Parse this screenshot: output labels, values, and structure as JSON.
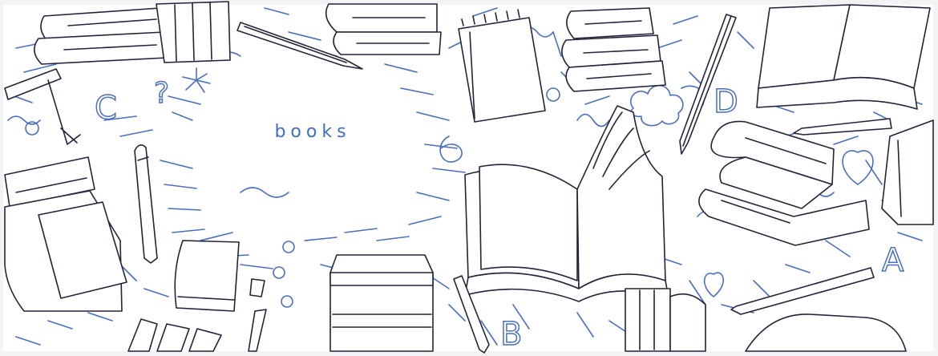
{
  "banner": {
    "title": "books",
    "colors": {
      "accent": "#3f6ec6",
      "line_ink": "#23233a",
      "doodle_blue": "#4a6fbf",
      "background": "#ffffff"
    },
    "illustration": {
      "icons": [
        "book-stack-icon",
        "open-book-icon",
        "notepad-icon",
        "pen-icon",
        "pencil-icon",
        "eraser-icon",
        "heart-icon",
        "cloud-icon",
        "letter-doodle-icon"
      ]
    }
  }
}
